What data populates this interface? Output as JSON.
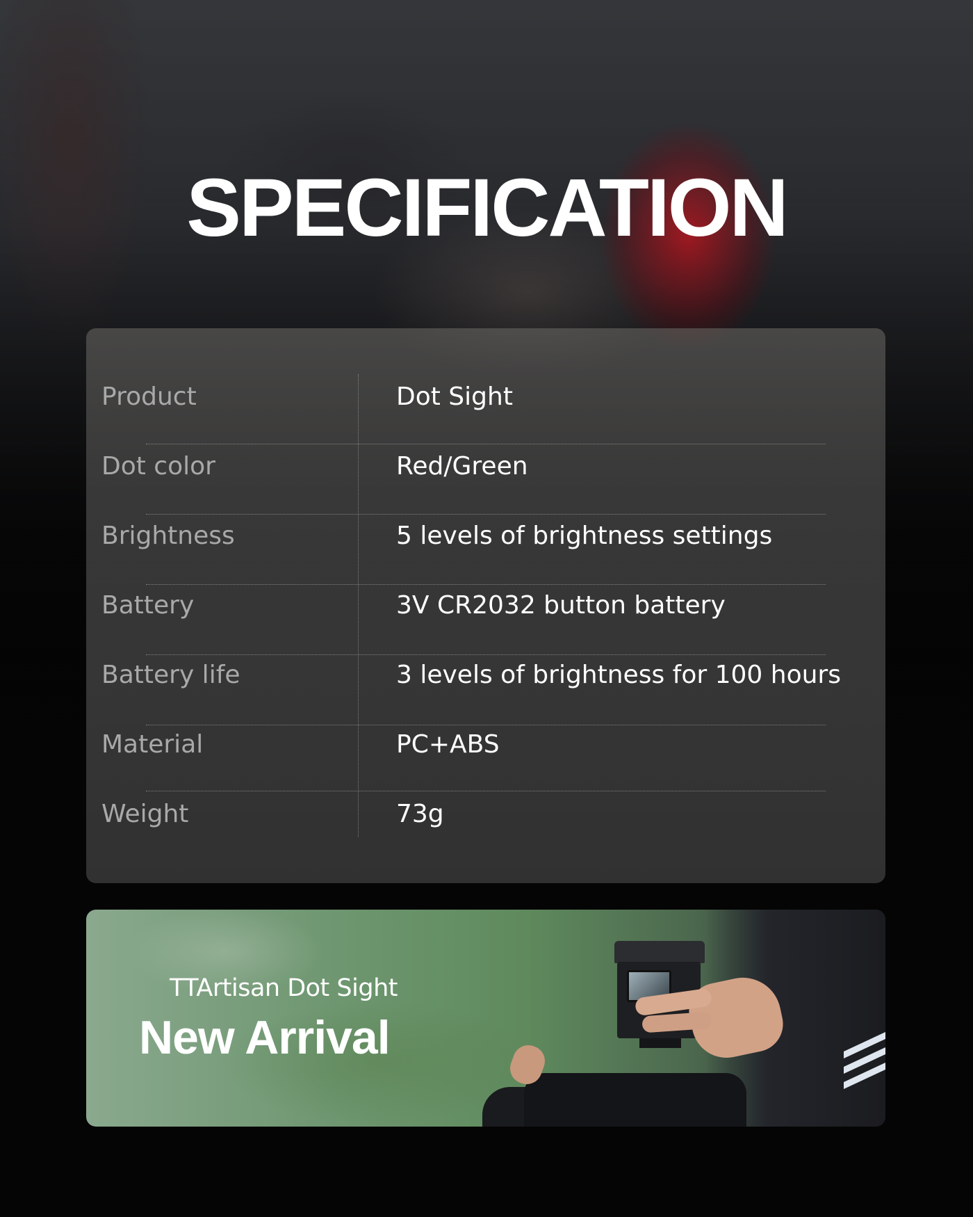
{
  "page": {
    "title": "SPECIFICATION"
  },
  "specs": [
    {
      "label": "Product",
      "value": "Dot Sight"
    },
    {
      "label": "Dot color",
      "value": "Red/Green"
    },
    {
      "label": "Brightness",
      "value": "5 levels of brightness settings"
    },
    {
      "label": "Battery",
      "value": "3V CR2032 button battery"
    },
    {
      "label": "Battery life",
      "value": "3 levels of brightness for 100 hours"
    },
    {
      "label": "Material",
      "value": "PC+ABS"
    },
    {
      "label": "Weight",
      "value": "73g"
    }
  ],
  "banner": {
    "subtitle": "TTArtisan Dot Sight",
    "title": "New Arrival"
  },
  "colors": {
    "background": "#050505",
    "card": "#333333",
    "label_text": "#a9a9a9",
    "value_text": "#ffffff"
  }
}
